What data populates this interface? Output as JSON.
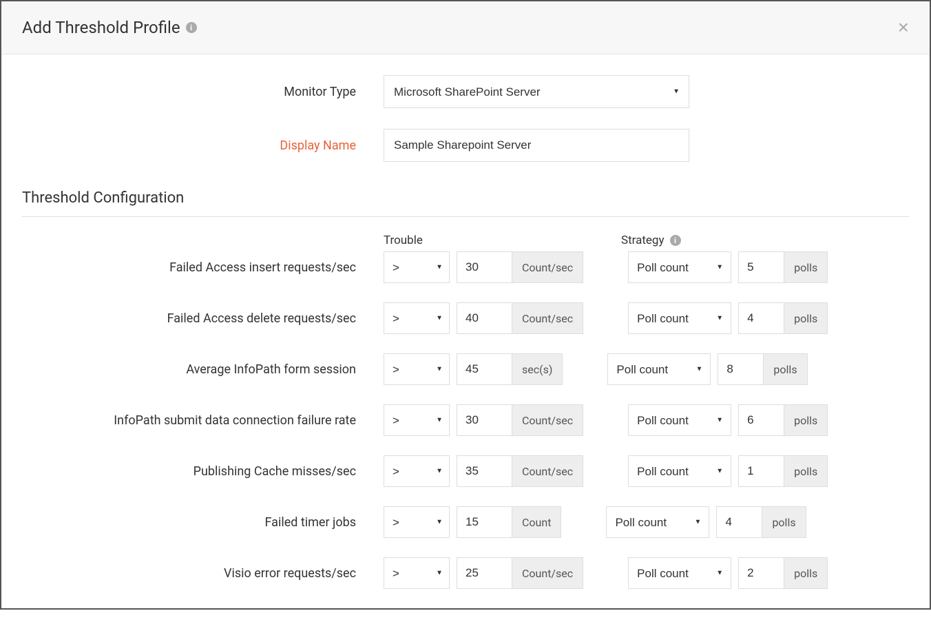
{
  "header": {
    "title": "Add Threshold Profile"
  },
  "form": {
    "monitorType": {
      "label": "Monitor Type",
      "value": "Microsoft SharePoint Server"
    },
    "displayName": {
      "label": "Display Name",
      "value": "Sample Sharepoint Server"
    }
  },
  "section": {
    "title": "Threshold Configuration",
    "troubleHeader": "Trouble",
    "strategyHeader": "Strategy"
  },
  "rows": [
    {
      "label": "Failed Access insert requests/sec",
      "op": ">",
      "val": "30",
      "unit": "Count/sec",
      "strategy": "Poll count",
      "polls": "5",
      "pollUnit": "polls"
    },
    {
      "label": "Failed Access delete requests/sec",
      "op": ">",
      "val": "40",
      "unit": "Count/sec",
      "strategy": "Poll count",
      "polls": "4",
      "pollUnit": "polls"
    },
    {
      "label": "Average InfoPath form session",
      "op": ">",
      "val": "45",
      "unit": "sec(s)",
      "strategy": "Poll count",
      "polls": "8",
      "pollUnit": "polls"
    },
    {
      "label": "InfoPath submit data connection failure rate",
      "op": ">",
      "val": "30",
      "unit": "Count/sec",
      "strategy": "Poll count",
      "polls": "6",
      "pollUnit": "polls"
    },
    {
      "label": "Publishing Cache misses/sec",
      "op": ">",
      "val": "35",
      "unit": "Count/sec",
      "strategy": "Poll count",
      "polls": "1",
      "pollUnit": "polls"
    },
    {
      "label": "Failed timer jobs",
      "op": ">",
      "val": "15",
      "unit": "Count",
      "strategy": "Poll count",
      "polls": "4",
      "pollUnit": "polls"
    },
    {
      "label": "Visio error requests/sec",
      "op": ">",
      "val": "25",
      "unit": "Count/sec",
      "strategy": "Poll count",
      "polls": "2",
      "pollUnit": "polls"
    }
  ]
}
